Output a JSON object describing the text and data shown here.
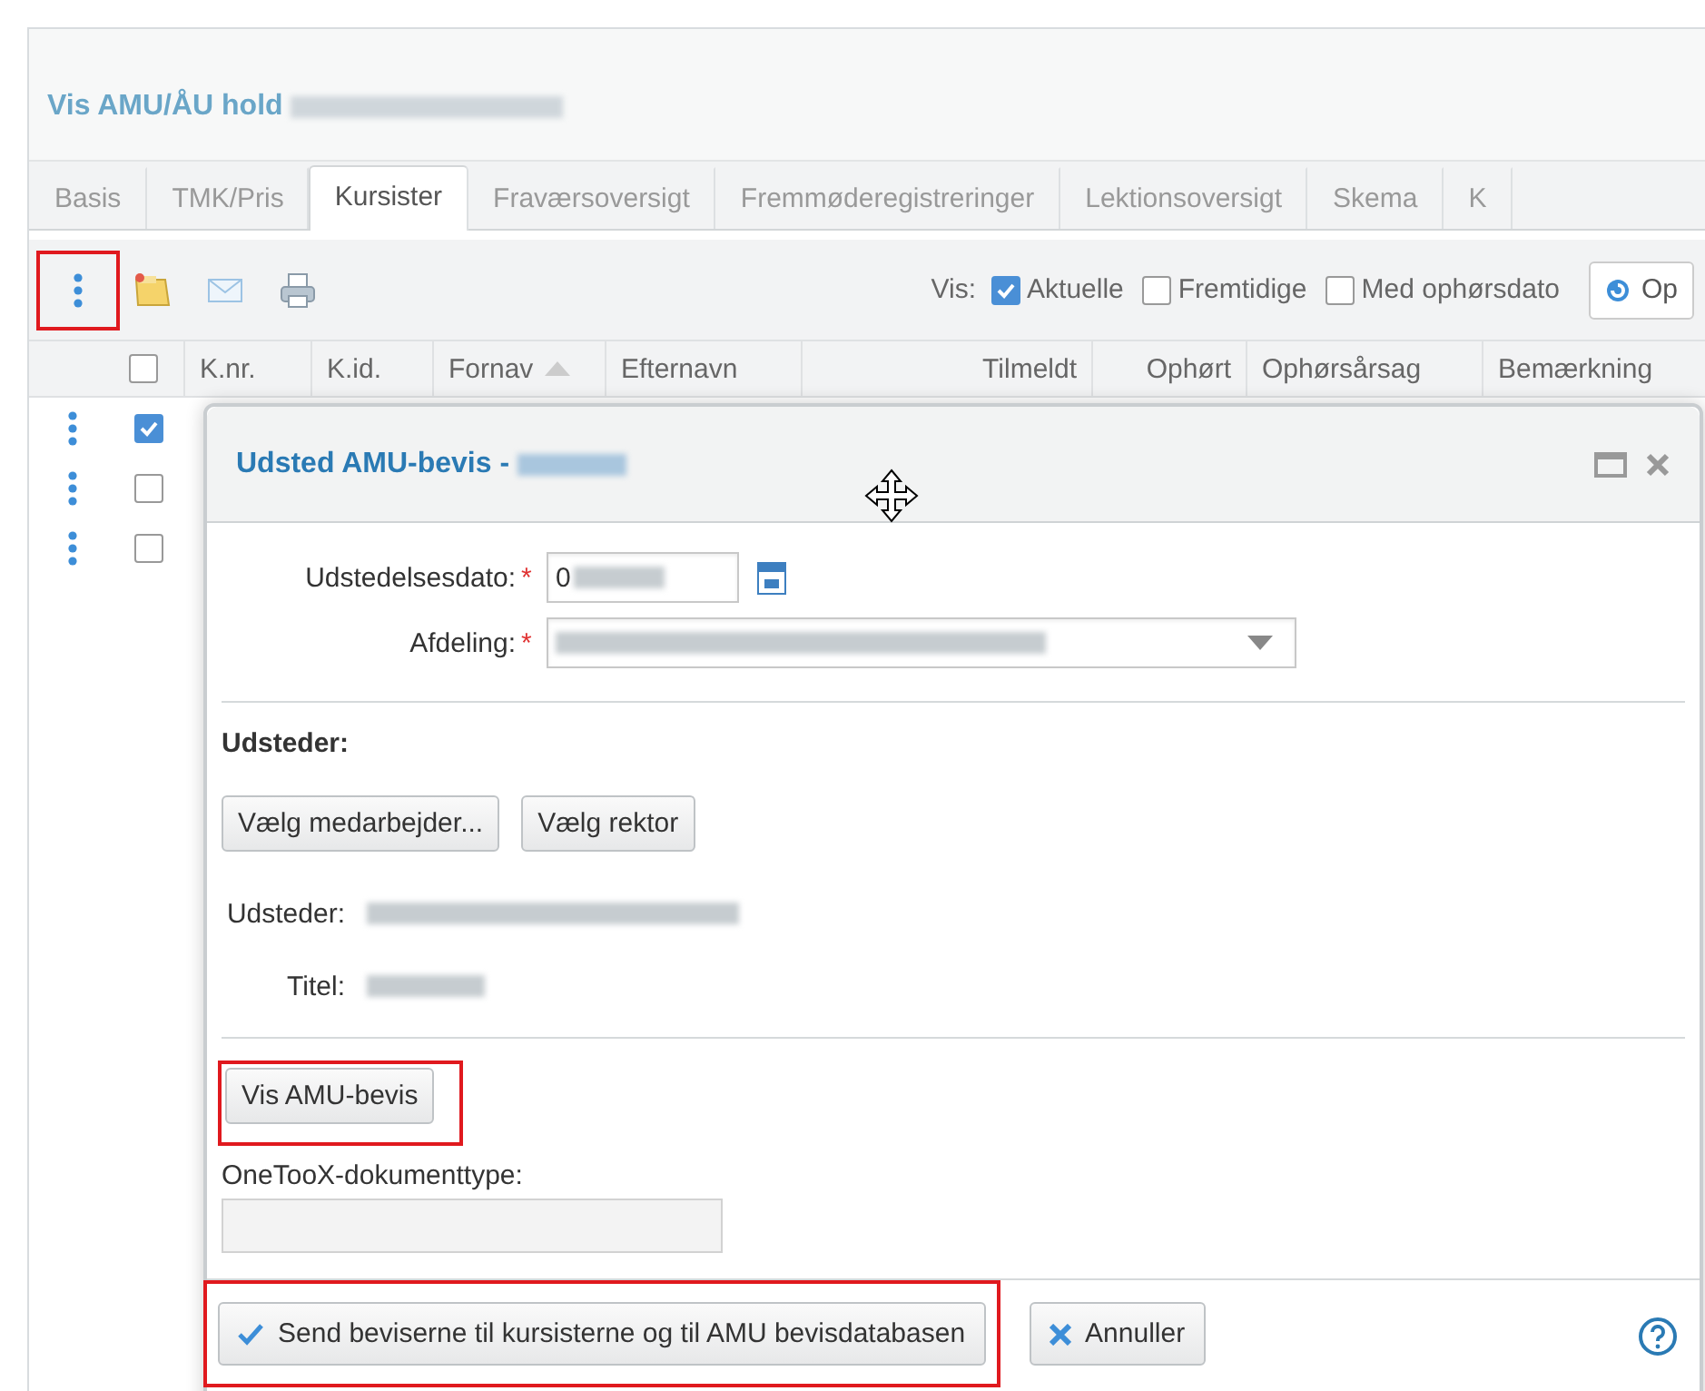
{
  "page": {
    "title": "Vis AMU/ÅU hold"
  },
  "tabs": [
    {
      "label": "Basis",
      "selected": false
    },
    {
      "label": "TMK/Pris",
      "selected": false
    },
    {
      "label": "Kursister",
      "selected": true
    },
    {
      "label": "Fraværsoversigt",
      "selected": false
    },
    {
      "label": "Fremmøderegistreringer",
      "selected": false
    },
    {
      "label": "Lektionsoversigt",
      "selected": false
    },
    {
      "label": "Skema",
      "selected": false
    },
    {
      "label": "K",
      "selected": false
    }
  ],
  "toolbar": {
    "menu_highlighted": true,
    "vis_label": "Vis:",
    "filters": [
      {
        "label": "Aktuelle",
        "checked": true
      },
      {
        "label": "Fremtidige",
        "checked": false
      },
      {
        "label": "Med ophørsdato",
        "checked": false
      }
    ],
    "refresh_button": "Op"
  },
  "table": {
    "header_checked": false,
    "columns": [
      {
        "label": "K.nr.",
        "sorted": false,
        "kind": "text"
      },
      {
        "label": "K.id.",
        "sorted": false,
        "kind": "text"
      },
      {
        "label": "Fornav",
        "sorted": true,
        "kind": "text"
      },
      {
        "label": "Efternavn",
        "sorted": false,
        "kind": "text"
      },
      {
        "label": "Tilmeldt",
        "sorted": false,
        "kind": "date"
      },
      {
        "label": "Ophørt",
        "sorted": false,
        "kind": "date"
      },
      {
        "label": "Ophørsårsag",
        "sorted": false,
        "kind": "text"
      },
      {
        "label": "Bemærkning",
        "sorted": false,
        "kind": "text"
      }
    ],
    "rows": [
      {
        "checked": true
      },
      {
        "checked": false
      },
      {
        "checked": false
      }
    ]
  },
  "dialog": {
    "title": "Udsted AMU-bevis -",
    "fields": [
      {
        "kind": "date",
        "label": "Udstedelsesdato:",
        "required_mark": "*",
        "value": "0"
      },
      {
        "kind": "select",
        "label": "Afdeling:",
        "required_mark": "*"
      }
    ],
    "issuer_heading": "Udsteder:",
    "issuer_buttons": [
      "Vælg medarbejder...",
      "Vælg rektor"
    ],
    "info": [
      {
        "label": "Udsteder:"
      },
      {
        "label": "Titel:"
      }
    ],
    "show_button": {
      "label": "Vis AMU-bevis",
      "highlighted": true
    },
    "doctype": {
      "label": "OneTooX-dokumenttype:"
    },
    "actions": [
      {
        "kind": "confirm",
        "label": "Send beviserne til kursisterne og til AMU bevisdatabasen",
        "highlighted": true
      },
      {
        "kind": "cancel",
        "label": "Annuller",
        "highlighted": false
      }
    ]
  }
}
